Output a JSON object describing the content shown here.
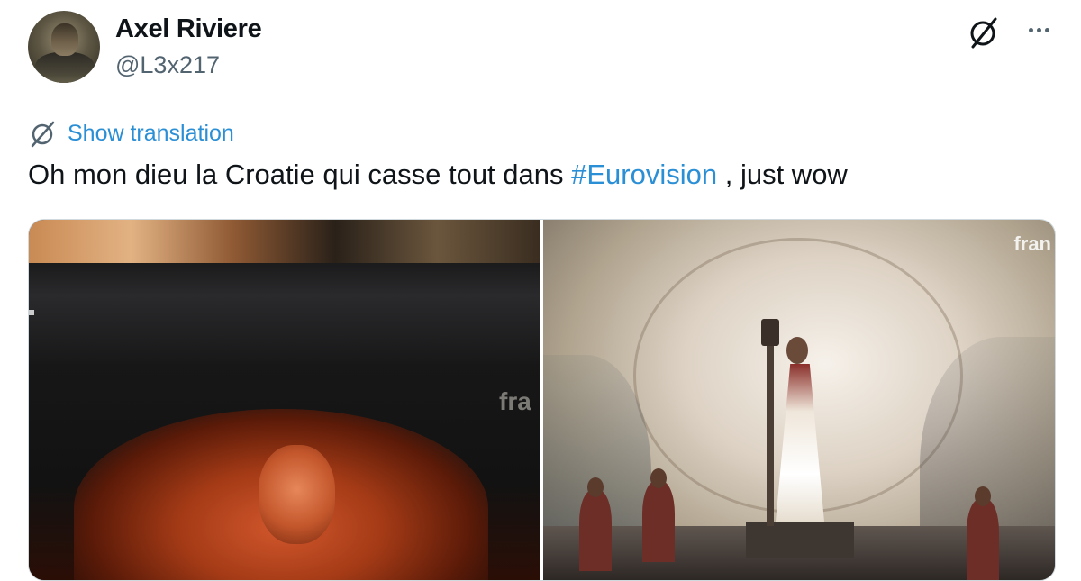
{
  "author": {
    "display_name": "Axel Riviere",
    "handle": "@L3x217"
  },
  "icons": {
    "top_right": "slashed-circle-icon",
    "more": "more-horizontal-icon",
    "translate": "slashed-circle-icon"
  },
  "translation": {
    "label": "Show translation"
  },
  "tweet": {
    "text_before": "Oh mon dieu la Croatie qui casse tout dans ",
    "hashtag": "#Eurovision",
    "text_after": " , just wow"
  },
  "media": {
    "left_watermark": "fra",
    "right_watermark": "fran"
  },
  "colors": {
    "text": "#0f1419",
    "secondary": "#536471",
    "link": "#2b8fd6",
    "border": "#cfd9de"
  }
}
